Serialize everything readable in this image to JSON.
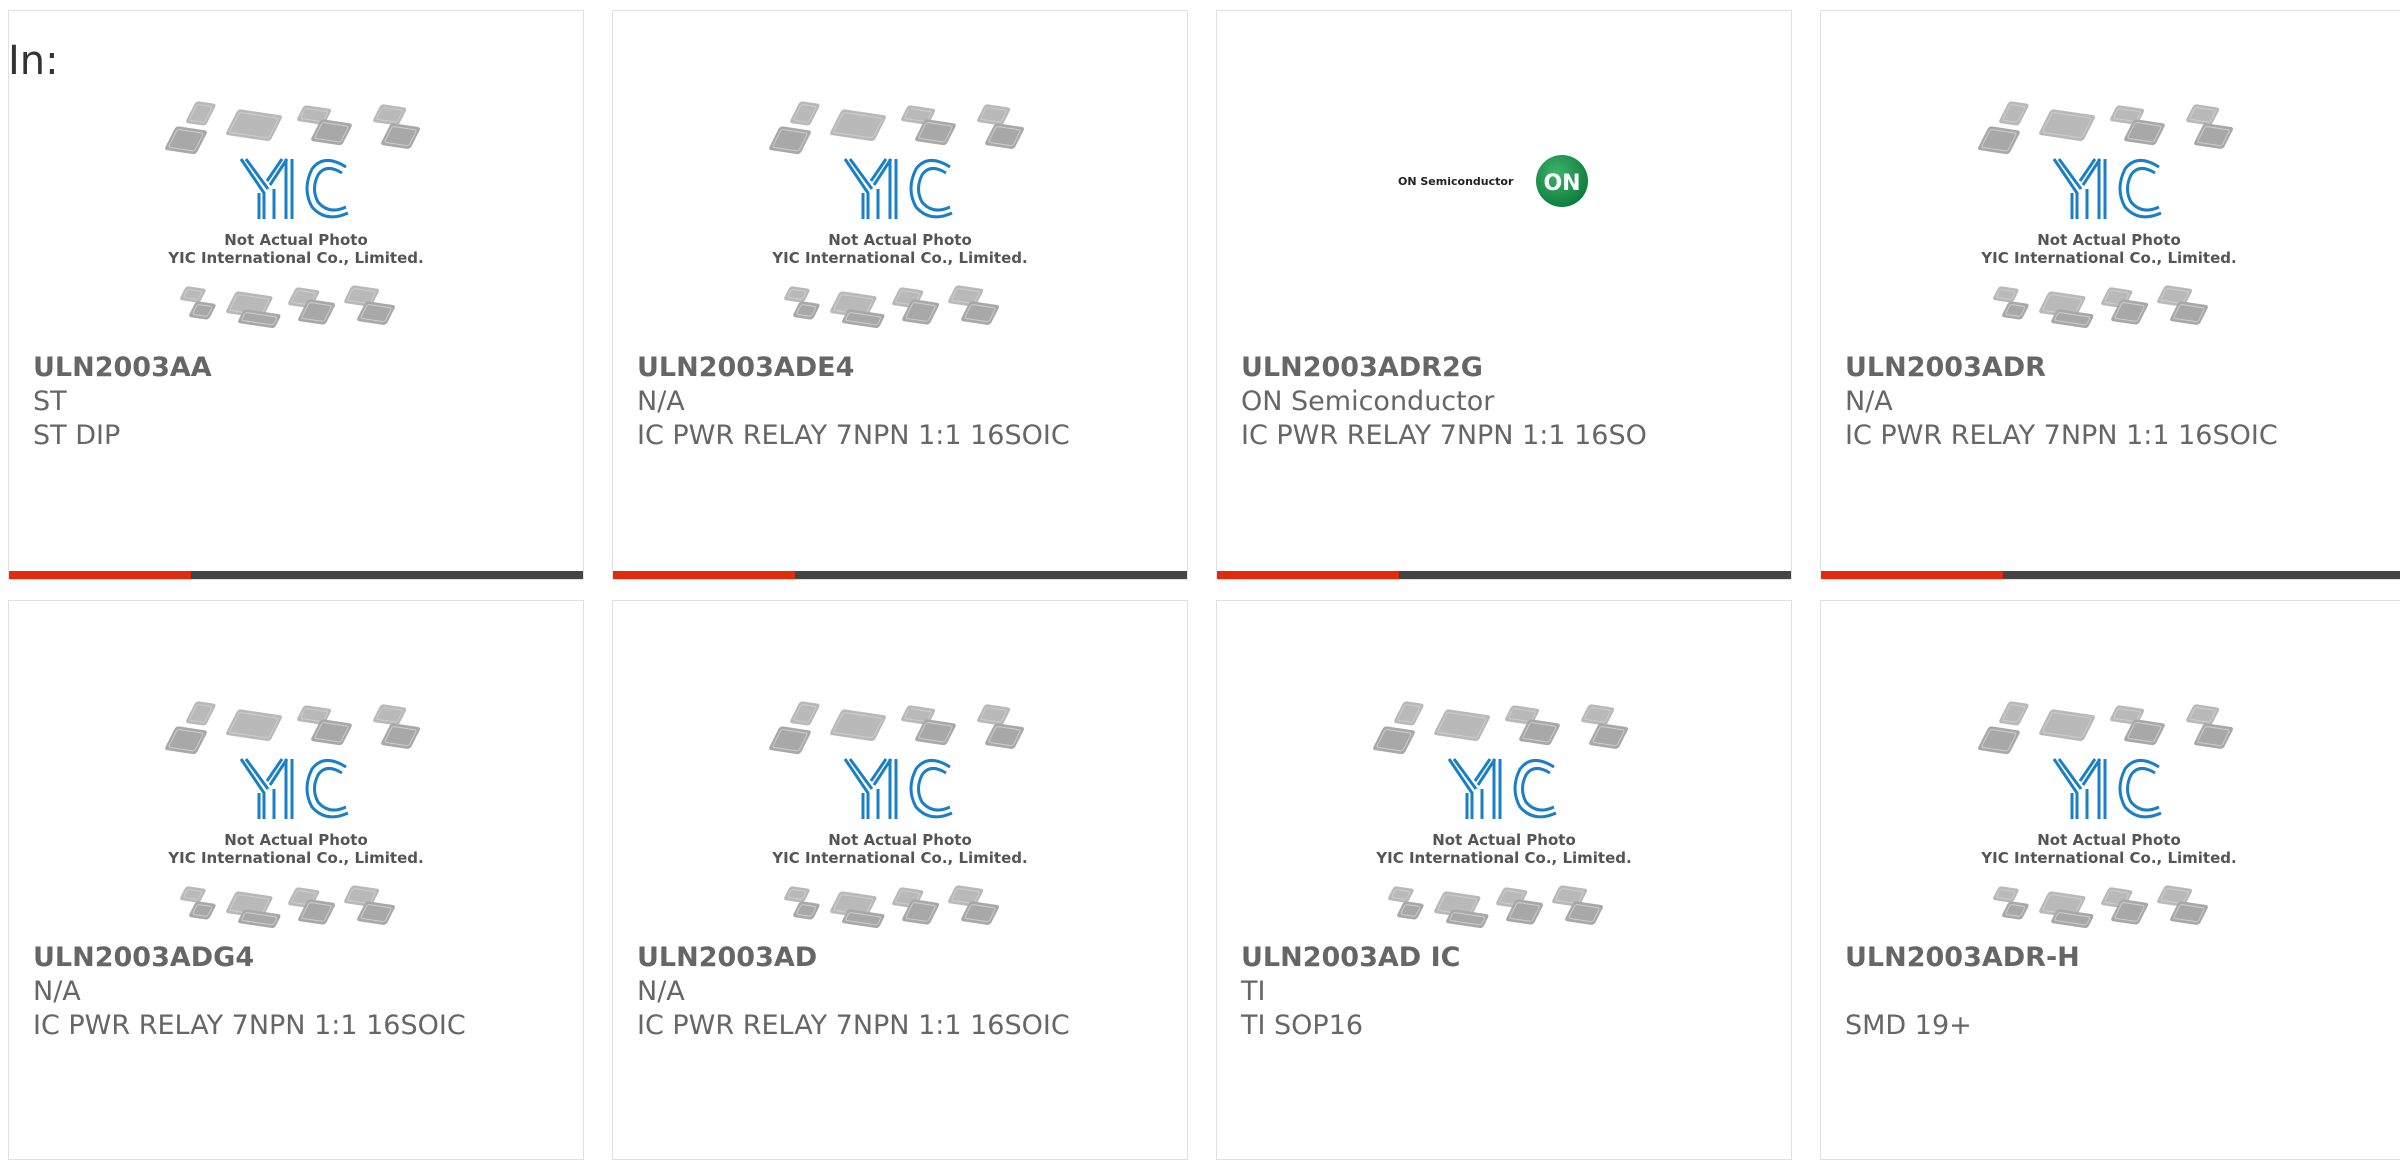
{
  "header": {
    "in_label": "In:"
  },
  "placeholder": {
    "line1": "Not Actual Photo",
    "line2": "YIC International Co., Limited."
  },
  "on_logo": {
    "wordmark": "ON Semiconductor",
    "badge": "ON"
  },
  "colors": {
    "accent": "#e02c0c",
    "bar": "#444444",
    "yic_blue": "#1a7fc4"
  },
  "cards": [
    {
      "part": "ULN2003AA",
      "mfr": "ST",
      "desc": "ST DIP",
      "image": "yic-placeholder"
    },
    {
      "part": "ULN2003ADE4",
      "mfr": "N/A",
      "desc": "IC PWR RELAY 7NPN 1:1 16SOIC",
      "image": "yic-placeholder"
    },
    {
      "part": "ULN2003ADR2G",
      "mfr": "ON Semiconductor",
      "desc": "IC PWR RELAY 7NPN 1:1 16SO",
      "image": "on-semiconductor-logo"
    },
    {
      "part": "ULN2003ADR",
      "mfr": "N/A",
      "desc": "IC PWR RELAY 7NPN 1:1 16SOIC",
      "image": "yic-placeholder"
    },
    {
      "part": "ULN2003ADG4",
      "mfr": "N/A",
      "desc": "IC PWR RELAY 7NPN 1:1 16SOIC",
      "image": "yic-placeholder"
    },
    {
      "part": "ULN2003AD",
      "mfr": "N/A",
      "desc": "IC PWR RELAY 7NPN 1:1 16SOIC",
      "image": "yic-placeholder"
    },
    {
      "part": "ULN2003AD IC",
      "mfr": "TI",
      "desc": "TI SOP16",
      "image": "yic-placeholder"
    },
    {
      "part": "ULN2003ADR-H",
      "mfr": "",
      "desc": "SMD 19+",
      "image": "yic-placeholder"
    }
  ]
}
